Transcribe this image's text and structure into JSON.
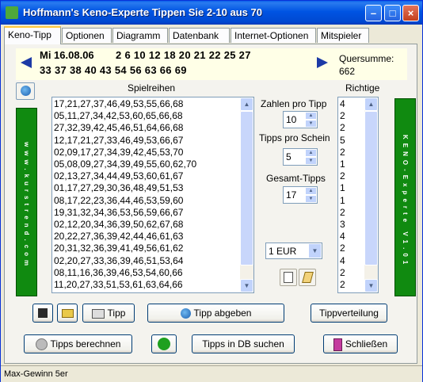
{
  "window": {
    "title": "Hoffmann's Keno-Experte  Tippen Sie 2-10 aus 70",
    "min_label": "–",
    "max_label": "□",
    "close_label": "×"
  },
  "tabs": [
    {
      "label": "Keno-Tipp"
    },
    {
      "label": "Optionen"
    },
    {
      "label": "Diagramm"
    },
    {
      "label": "Datenbank"
    },
    {
      "label": "Internet-Optionen"
    },
    {
      "label": "Mitspieler"
    }
  ],
  "draw": {
    "date": "Mi 16.08.06",
    "line1": "2  6  10  12  18  20  21  22  25  27",
    "line2": "33  37  38  40  43  54  56  63  66  69",
    "quersumme_label": "Quersumme:",
    "quersumme_value": "662"
  },
  "sidebar_left": {
    "text": "www.kurstrend.com"
  },
  "sidebar_right": {
    "text": "KENO-Experte V1.01"
  },
  "spielreihen": {
    "header": "Spielreihen",
    "rows": [
      "17,21,27,37,46,49,53,55,66,68",
      "05,11,27,34,42,53,60,65,66,68",
      "27,32,39,42,45,46,51,64,66,68",
      "12,17,21,27,33,46,49,53,66,67",
      "02,09,17,27,34,39,42,45,53,70",
      "05,08,09,27,34,39,49,55,60,62,70",
      "02,13,27,34,44,49,53,60,61,67",
      "01,17,27,29,30,36,48,49,51,53",
      "08,17,22,23,36,44,46,53,59,60",
      "19,31,32,34,36,53,56,59,66,67",
      "02,12,20,34,36,39,50,62,67,68",
      "20,22,27,36,39,42,44,46,61,63",
      "20,31,32,36,39,41,49,56,61,62",
      "02,20,27,33,36,39,46,51,53,64",
      "08,11,16,36,39,46,53,54,60,66",
      "11,20,27,33,51,53,61,63,64,66"
    ]
  },
  "richtige": {
    "header": "Richtige",
    "values": [
      "4",
      "2",
      "2",
      "5",
      "2",
      "1",
      "2",
      "1",
      "1",
      "2",
      "3",
      "4",
      "2",
      "4",
      "2",
      "2"
    ]
  },
  "options": {
    "zahlen_label": "Zahlen pro Tipp",
    "zahlen_value": "10",
    "tipps_label": "Tipps pro Schein",
    "tipps_value": "5",
    "gesamt_label": "Gesamt-Tipps",
    "gesamt_value": "17",
    "currency": "1 EUR"
  },
  "buttons": {
    "tipp": "Tipp",
    "tipp_abgeben": "Tipp abgeben",
    "tippverteilung": "Tippverteilung",
    "tipps_berechnen": "Tipps berechnen",
    "tipps_db": "Tipps in DB suchen",
    "schliessen": "Schließen"
  },
  "status": {
    "text": "Max-Gewinn 5er"
  },
  "colors": {
    "titlebar": "#0054E3",
    "green": "#108A10",
    "draw_bg": "#FFFFE7",
    "arrow": "#1C3AA6"
  }
}
